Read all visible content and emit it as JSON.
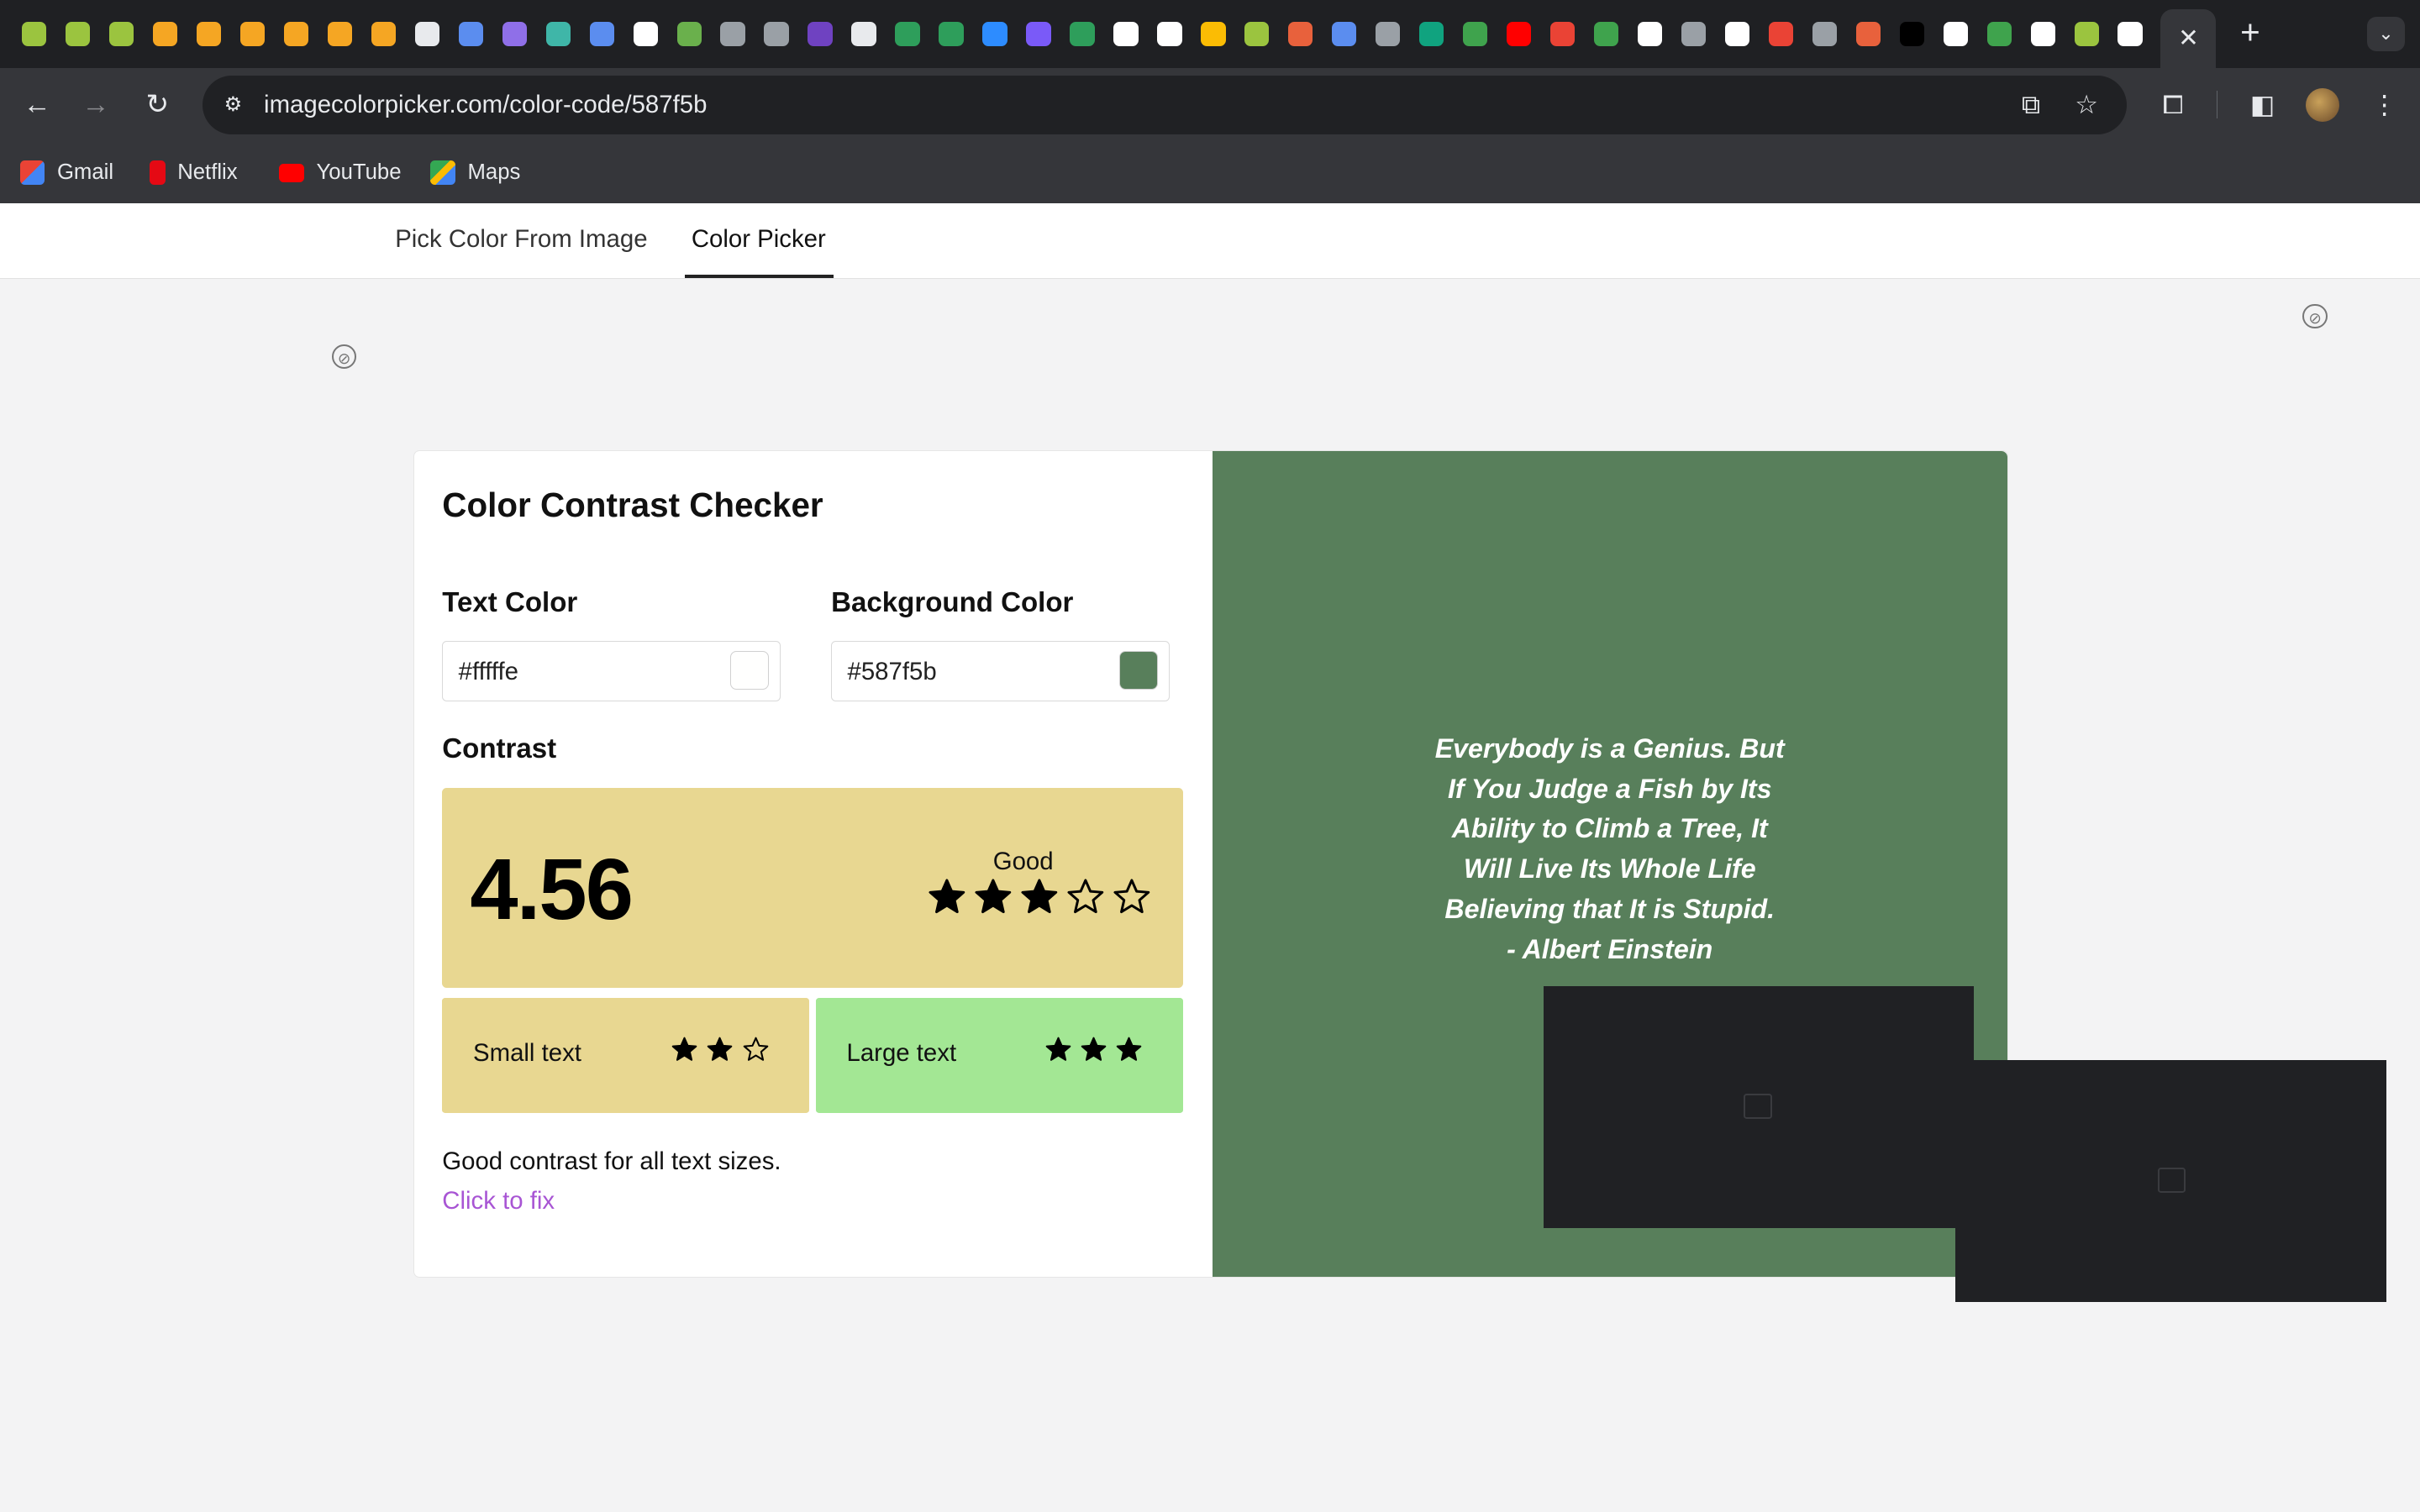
{
  "browser": {
    "tab_favicon_colors": [
      "#9bc43f",
      "#9bc43f",
      "#9bc43f",
      "#f5a623",
      "#f5a623",
      "#f5a623",
      "#f5a623",
      "#f5a623",
      "#f5a623",
      "#e8eaed",
      "#5b8def",
      "#8f6fe8",
      "#3fb6a8",
      "#5b8def",
      "#ffffff",
      "#6ab04c",
      "#9aa0a6",
      "#9aa0a6",
      "#6f42c1",
      "#e8eaed",
      "#2e9e5b",
      "#2e9e5b",
      "#2d8cff",
      "#7a5af8",
      "#2e9e5b",
      "#ffffff",
      "#ffffff",
      "#fbbc04",
      "#9bc43f",
      "#e8613c",
      "#5b8def",
      "#9aa0a6",
      "#10a37f",
      "#3fa34d",
      "#ff0000",
      "#ea4335",
      "#3fa34d",
      "#ffffff",
      "#9aa0a6",
      "#ffffff",
      "#ea4335",
      "#9aa0a6",
      "#e8613c",
      "#000000",
      "#ffffff",
      "#3fa34d",
      "#ffffff",
      "#9bc43f",
      "#ffffff"
    ],
    "active_tab_close": "✕",
    "new_tab": "+",
    "tab_search": "⌄",
    "url": "imagecolorpicker.com/color-code/587f5b",
    "bookmarks": [
      {
        "label": "Gmail",
        "color": "#ea4335"
      },
      {
        "label": "Netflix",
        "color": "#e50914"
      },
      {
        "label": "YouTube",
        "color": "#ff0000"
      },
      {
        "label": "Maps",
        "color": "#34a853"
      }
    ]
  },
  "page_nav": {
    "tabs": [
      "Pick Color From Image",
      "Color Picker"
    ],
    "active": "Color Picker"
  },
  "checker": {
    "title": "Color Contrast Checker",
    "text_color_label": "Text Color",
    "text_color_value": "#fffffe",
    "bg_color_label": "Background Color",
    "bg_color_value": "#587f5b",
    "contrast_label": "Contrast",
    "ratio": "4.56",
    "rating": "Good",
    "rating_stars": 3,
    "rating_stars_max": 5,
    "small_text_label": "Small text",
    "small_text_stars": 2,
    "small_text_stars_max": 3,
    "large_text_label": "Large text",
    "large_text_stars": 3,
    "large_text_stars_max": 3,
    "colors": {
      "ratio_box": "#e8d791",
      "small_box": "#e8d791",
      "large_box": "#a3e794",
      "fix_link": "#a855d4"
    },
    "status": "Good contrast for all text sizes.",
    "fix_link": "Click to fix"
  },
  "preview": {
    "quote_lines": [
      "Everybody is a Genius. But",
      "If You Judge a Fish by Its",
      "Ability to Climb a Tree, It",
      "Will Live Its Whole Life",
      "Believing that It is Stupid.",
      "- Albert Einstein"
    ]
  }
}
